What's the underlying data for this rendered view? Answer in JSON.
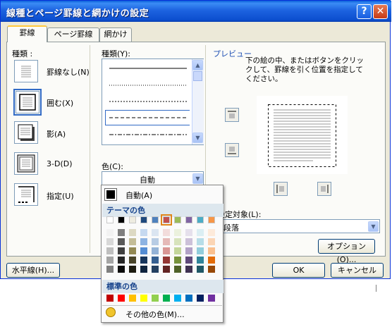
{
  "dialog": {
    "title": "線種とページ罫線と網かけの設定"
  },
  "titlebar": {
    "help": "?",
    "close": "✕"
  },
  "tabs": [
    {
      "label": "罫線"
    },
    {
      "label": "ページ罫線"
    },
    {
      "label": "網かけ"
    }
  ],
  "setting": {
    "label": "種類 :",
    "options": [
      {
        "label": "罫線なし(N)"
      },
      {
        "label": "囲む(X)"
      },
      {
        "label": "影(A)"
      },
      {
        "label": "3-D(D)"
      },
      {
        "label": "指定(U)"
      }
    ],
    "selected": "囲む(X)"
  },
  "style": {
    "label": "種類(Y):"
  },
  "color": {
    "label": "色(C):",
    "value": "自動"
  },
  "preview": {
    "label": "プレビュー",
    "instructions": "下の絵の中、またはボタンをクリックして、罫線を引く位置を指定してください。"
  },
  "apply_to": {
    "label": "設定対象(L):",
    "value": "段落"
  },
  "buttons": {
    "options": "オプション(O)...",
    "horizontal_line": "水平線(H)...",
    "ok": "OK",
    "cancel": "キャンセル"
  },
  "color_popup": {
    "automatic_label": "自動(A)",
    "theme_header": "テーマの色",
    "standard_header": "標準の色",
    "more_colors": "その他の色(M)...",
    "theme_top": [
      "#ffffff",
      "#000000",
      "#eeece1",
      "#1f497d",
      "#4f81bd",
      "#c0504d",
      "#9bbb59",
      "#8064a2",
      "#4bacc6",
      "#f79646"
    ],
    "theme_shades": [
      [
        "#f2f2f2",
        "#d8d8d8",
        "#bfbfbf",
        "#a5a5a5",
        "#7f7f7f"
      ],
      [
        "#7f7f7f",
        "#595959",
        "#3f3f3f",
        "#262626",
        "#0c0c0c"
      ],
      [
        "#ddd9c3",
        "#c4bd97",
        "#938953",
        "#494429",
        "#1d1b10"
      ],
      [
        "#c6d9f0",
        "#8db3e2",
        "#548dd4",
        "#17365d",
        "#0f243e"
      ],
      [
        "#dbe5f1",
        "#b8cce4",
        "#95b3d7",
        "#366092",
        "#244061"
      ],
      [
        "#f2dcdb",
        "#e5b9b7",
        "#d99694",
        "#953734",
        "#632423"
      ],
      [
        "#ebf1dd",
        "#d7e3bc",
        "#c3d69b",
        "#76923c",
        "#4f6128"
      ],
      [
        "#e5e0ec",
        "#ccc1d9",
        "#b2a2c7",
        "#5f497a",
        "#3f3151"
      ],
      [
        "#dbeef3",
        "#b7dde8",
        "#92cddc",
        "#31859b",
        "#205867"
      ],
      [
        "#fdeada",
        "#fbd5b5",
        "#fac08f",
        "#e36c09",
        "#974806"
      ]
    ],
    "selected_index": 5,
    "standard": [
      "#c00000",
      "#ff0000",
      "#ffc000",
      "#ffff00",
      "#92d050",
      "#00b050",
      "#00b0f0",
      "#0070c0",
      "#002060",
      "#7030a0"
    ]
  }
}
